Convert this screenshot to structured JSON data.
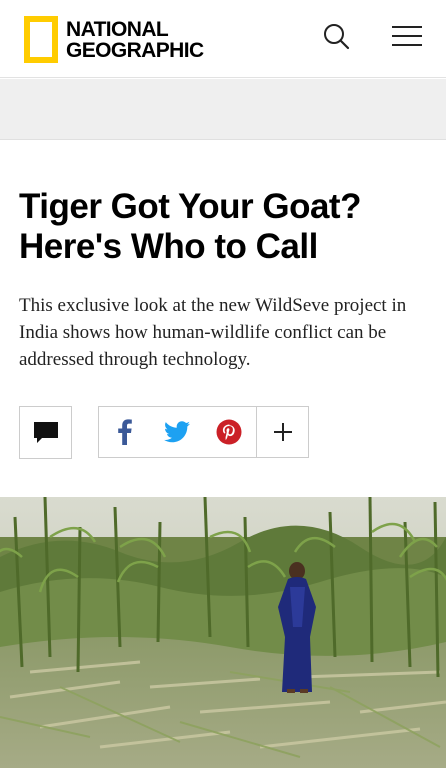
{
  "header": {
    "logo_line1": "NATIONAL",
    "logo_line2": "GEOGRAPHIC",
    "logo_color": "#ffcc00"
  },
  "article": {
    "title": "Tiger Got Your Goat? Here's Who to Call",
    "dek": "This exclusive look at the new WildSeve project in India shows how human-wildlife conflict can be addressed through technology."
  },
  "share": {
    "items": [
      "comment-icon",
      "facebook-icon",
      "twitter-icon",
      "pinterest-icon",
      "plus-icon"
    ],
    "colors": {
      "facebook": "#3b5998",
      "twitter": "#1da1f2",
      "pinterest": "#cb2027"
    }
  },
  "hero": {
    "description": "woman in blue sari standing in a trampled maize field"
  }
}
